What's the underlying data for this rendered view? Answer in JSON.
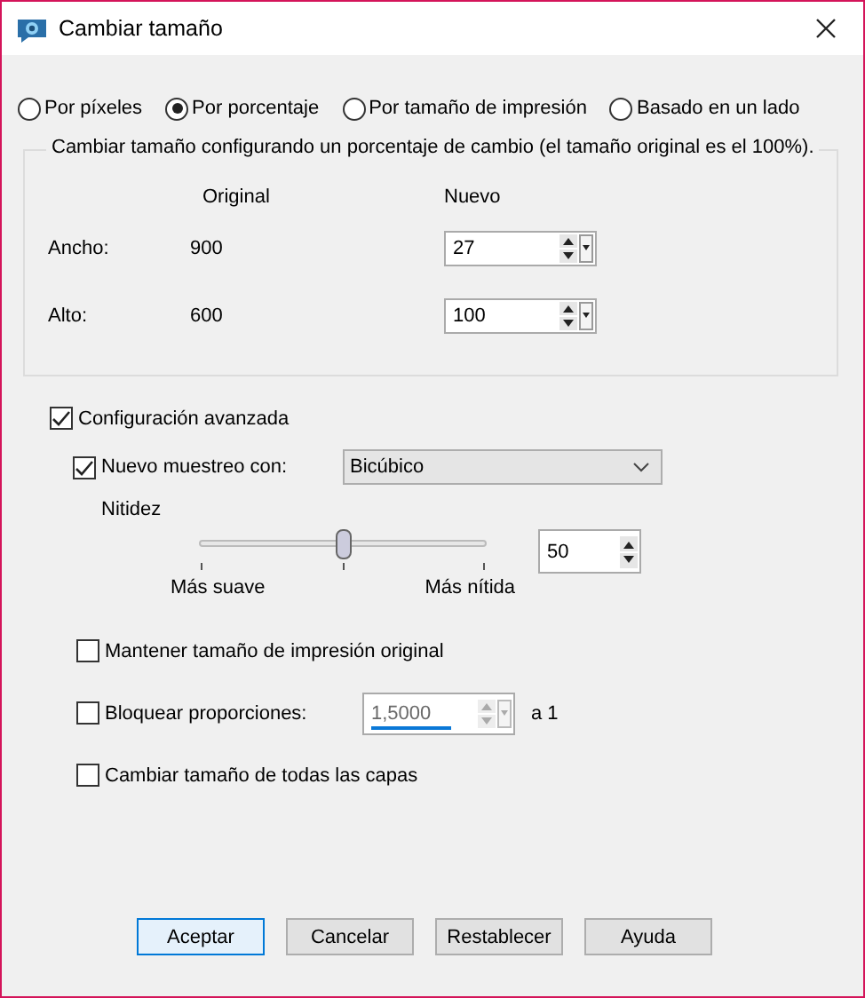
{
  "window": {
    "title": "Cambiar tamaño"
  },
  "modes": [
    {
      "label": "Por píxeles",
      "selected": false
    },
    {
      "label": "Por porcentaje",
      "selected": true
    },
    {
      "label": "Por tamaño de impresión",
      "selected": false
    },
    {
      "label": "Basado en un lado",
      "selected": false
    }
  ],
  "group": {
    "legend": "Cambiar tamaño configurando un porcentaje de cambio (el tamaño original es el 100%).",
    "column_headers": [
      "Original",
      "Nuevo"
    ],
    "rows": [
      {
        "label": "Ancho:",
        "original": "900",
        "value": "27"
      },
      {
        "label": "Alto:",
        "original": "600",
        "value": "100"
      }
    ]
  },
  "advanced": {
    "label": "Configuración avanzada",
    "checked": true
  },
  "resample": {
    "label": "Nuevo muestreo con:",
    "checked": true,
    "method": "Bicúbico"
  },
  "sharpness": {
    "label": "Nitidez",
    "level": 0.5,
    "value": "50",
    "min_label": "Más suave",
    "max_label": "Más nítida"
  },
  "options": [
    {
      "kind": "checkbox",
      "label": "Mantener tamaño de impresión original",
      "checked": false
    },
    {
      "kind": "ratio",
      "label": "Bloquear proporciones:",
      "checked": false,
      "value": "1,5000",
      "suffix": "a 1"
    },
    {
      "kind": "checkbox",
      "label": "Cambiar tamaño de todas las capas",
      "checked": false
    }
  ],
  "buttons": [
    {
      "label": "Aceptar",
      "default": true
    },
    {
      "label": "Cancelar",
      "default": false
    },
    {
      "label": "Restablecer",
      "default": false
    },
    {
      "label": "Ayuda",
      "default": false
    }
  ]
}
